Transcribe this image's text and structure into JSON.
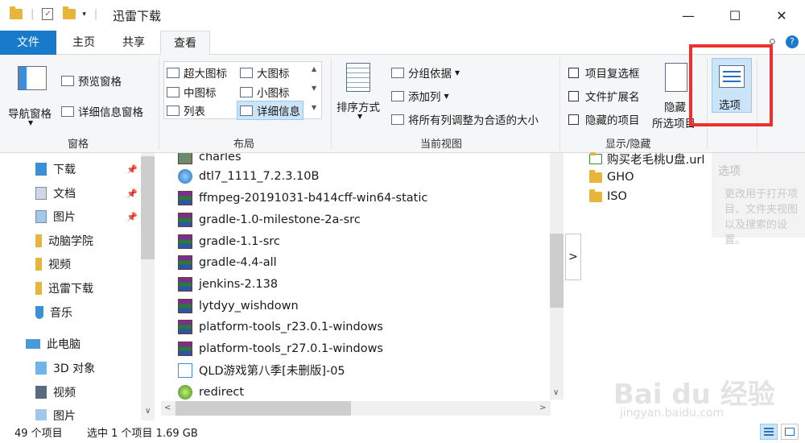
{
  "window": {
    "title": "迅雷下载",
    "minimize": "—",
    "maximize": "☐",
    "close": "✕"
  },
  "tabs": [
    "文件",
    "主页",
    "共享",
    "查看"
  ],
  "ribbon": {
    "panes": {
      "label": "窗格",
      "nav_pane": "导航窗格",
      "preview_pane": "预览窗格",
      "details_pane": "详细信息窗格"
    },
    "layout": {
      "label": "布局",
      "items": [
        "超大图标",
        "大图标",
        "中图标",
        "小图标",
        "列表",
        "详细信息"
      ]
    },
    "current_view": {
      "label": "当前视图",
      "sort": "排序方式",
      "group_by": "分组依据",
      "add_column": "添加列",
      "fit_columns": "将所有列调整为合适的大小"
    },
    "show_hide": {
      "label": "显示/隐藏",
      "item_checkboxes": "项目复选框",
      "file_extensions": "文件扩展名",
      "hidden_items": "隐藏的项目",
      "hide_selected_line1": "隐藏",
      "hide_selected_line2": "所选项目"
    },
    "options": "选项"
  },
  "nav": {
    "items": [
      {
        "label": "下载",
        "pinned": true
      },
      {
        "label": "文档",
        "pinned": true
      },
      {
        "label": "图片",
        "pinned": true
      },
      {
        "label": "动脑学院",
        "pinned": false
      },
      {
        "label": "视频",
        "pinned": false
      },
      {
        "label": "迅雷下载",
        "pinned": false
      },
      {
        "label": "音乐",
        "pinned": false
      },
      {
        "label": "此电脑",
        "pinned": false
      },
      {
        "label": "3D 对象",
        "pinned": false
      },
      {
        "label": "视频",
        "pinned": false
      },
      {
        "label": "图片",
        "pinned": false
      }
    ]
  },
  "files": [
    "charles",
    "dtl7_1111_7.2.3.10B",
    "ffmpeg-20191031-b414cff-win64-static",
    "gradle-1.0-milestone-2a-src",
    "gradle-1.1-src",
    "gradle-4.4-all",
    "jenkins-2.138",
    "lytdyy_wishdown",
    "platform-tools_r23.0.1-windows",
    "platform-tools_r27.0.1-windows",
    "QLD游戏第八季[未删版]-05",
    "redirect"
  ],
  "right_list": [
    "购买老毛桃U盘.url",
    "GHO",
    "ISO"
  ],
  "preview": {
    "title": "选项",
    "desc": "更改用于打开项目、文件夹视图以及搜索的设置。"
  },
  "status": {
    "count": "49 个项目",
    "selected": "选中 1 个项目  1.69 GB"
  },
  "watermark": {
    "main": "Bai du 经验",
    "sub": "jingyan.baidu.com"
  },
  "colors": {
    "file_tab": "#1979ca",
    "selection": "#cce4f7",
    "highlight_box": "#ee2f2f"
  }
}
